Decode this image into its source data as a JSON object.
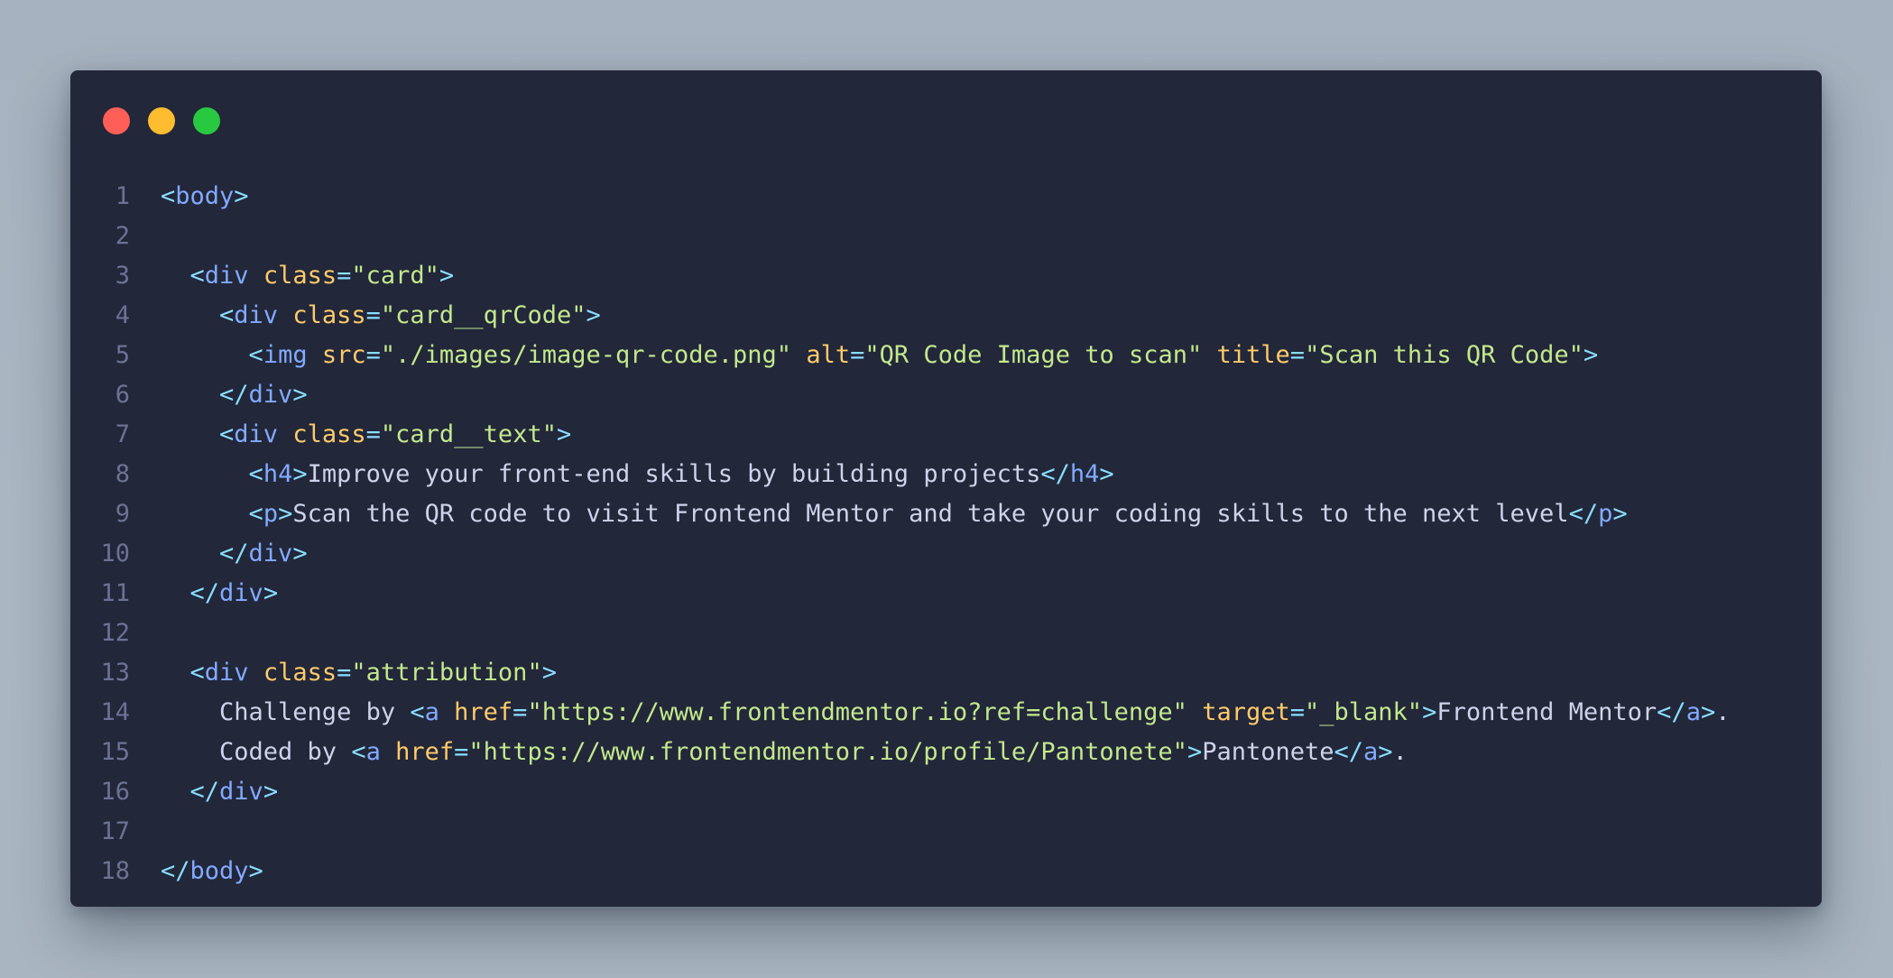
{
  "colors": {
    "background": "#aab6c2",
    "window": "#22273a",
    "line_number": "#6b7394",
    "punctuation": "#89ddff",
    "tag": "#82aaff",
    "attribute": "#ffcb6b",
    "string": "#c3e88d",
    "text": "#cdd3ea",
    "close_dot": "#ff5f57",
    "minimize_dot": "#febc2e",
    "zoom_dot": "#28c840"
  },
  "lines": [
    {
      "n": "1",
      "tokens": [
        [
          "p",
          "<"
        ],
        [
          "t",
          "body"
        ],
        [
          "p",
          ">"
        ]
      ]
    },
    {
      "n": "2",
      "tokens": []
    },
    {
      "n": "3",
      "tokens": [
        [
          "x",
          "  "
        ],
        [
          "p",
          "<"
        ],
        [
          "t",
          "div"
        ],
        [
          "x",
          " "
        ],
        [
          "a",
          "class"
        ],
        [
          "p",
          "="
        ],
        [
          "s",
          "\"card\""
        ],
        [
          "p",
          ">"
        ]
      ]
    },
    {
      "n": "4",
      "tokens": [
        [
          "x",
          "    "
        ],
        [
          "p",
          "<"
        ],
        [
          "t",
          "div"
        ],
        [
          "x",
          " "
        ],
        [
          "a",
          "class"
        ],
        [
          "p",
          "="
        ],
        [
          "s",
          "\"card__qrCode\""
        ],
        [
          "p",
          ">"
        ]
      ]
    },
    {
      "n": "5",
      "tokens": [
        [
          "x",
          "      "
        ],
        [
          "p",
          "<"
        ],
        [
          "t",
          "img"
        ],
        [
          "x",
          " "
        ],
        [
          "a",
          "src"
        ],
        [
          "p",
          "="
        ],
        [
          "s",
          "\"./images/image-qr-code.png\""
        ],
        [
          "x",
          " "
        ],
        [
          "a",
          "alt"
        ],
        [
          "p",
          "="
        ],
        [
          "s",
          "\"QR Code Image to scan\""
        ],
        [
          "x",
          " "
        ],
        [
          "a",
          "title"
        ],
        [
          "p",
          "="
        ],
        [
          "s",
          "\"Scan this QR Code\""
        ],
        [
          "p",
          ">"
        ]
      ]
    },
    {
      "n": "6",
      "tokens": [
        [
          "x",
          "    "
        ],
        [
          "p",
          "</"
        ],
        [
          "t",
          "div"
        ],
        [
          "p",
          ">"
        ]
      ]
    },
    {
      "n": "7",
      "tokens": [
        [
          "x",
          "    "
        ],
        [
          "p",
          "<"
        ],
        [
          "t",
          "div"
        ],
        [
          "x",
          " "
        ],
        [
          "a",
          "class"
        ],
        [
          "p",
          "="
        ],
        [
          "s",
          "\"card__text\""
        ],
        [
          "p",
          ">"
        ]
      ]
    },
    {
      "n": "8",
      "tokens": [
        [
          "x",
          "      "
        ],
        [
          "p",
          "<"
        ],
        [
          "t",
          "h4"
        ],
        [
          "p",
          ">"
        ],
        [
          "x",
          "Improve your front-end skills by building projects"
        ],
        [
          "p",
          "</"
        ],
        [
          "t",
          "h4"
        ],
        [
          "p",
          ">"
        ]
      ]
    },
    {
      "n": "9",
      "tokens": [
        [
          "x",
          "      "
        ],
        [
          "p",
          "<"
        ],
        [
          "t",
          "p"
        ],
        [
          "p",
          ">"
        ],
        [
          "x",
          "Scan the QR code to visit Frontend Mentor and take your coding skills to the next level"
        ],
        [
          "p",
          "</"
        ],
        [
          "t",
          "p"
        ],
        [
          "p",
          ">"
        ]
      ]
    },
    {
      "n": "10",
      "tokens": [
        [
          "x",
          "    "
        ],
        [
          "p",
          "</"
        ],
        [
          "t",
          "div"
        ],
        [
          "p",
          ">"
        ]
      ]
    },
    {
      "n": "11",
      "tokens": [
        [
          "x",
          "  "
        ],
        [
          "p",
          "</"
        ],
        [
          "t",
          "div"
        ],
        [
          "p",
          ">"
        ]
      ]
    },
    {
      "n": "12",
      "tokens": []
    },
    {
      "n": "13",
      "tokens": [
        [
          "x",
          "  "
        ],
        [
          "p",
          "<"
        ],
        [
          "t",
          "div"
        ],
        [
          "x",
          " "
        ],
        [
          "a",
          "class"
        ],
        [
          "p",
          "="
        ],
        [
          "s",
          "\"attribution\""
        ],
        [
          "p",
          ">"
        ]
      ]
    },
    {
      "n": "14",
      "tokens": [
        [
          "x",
          "    Challenge by "
        ],
        [
          "p",
          "<"
        ],
        [
          "t",
          "a"
        ],
        [
          "x",
          " "
        ],
        [
          "a",
          "href"
        ],
        [
          "p",
          "="
        ],
        [
          "s",
          "\"https://www.frontendmentor.io?ref=challenge\""
        ],
        [
          "x",
          " "
        ],
        [
          "a",
          "target"
        ],
        [
          "p",
          "="
        ],
        [
          "s",
          "\"_blank\""
        ],
        [
          "p",
          ">"
        ],
        [
          "x",
          "Frontend Mentor"
        ],
        [
          "p",
          "</"
        ],
        [
          "t",
          "a"
        ],
        [
          "p",
          ">"
        ],
        [
          "x",
          "."
        ]
      ]
    },
    {
      "n": "15",
      "tokens": [
        [
          "x",
          "    Coded by "
        ],
        [
          "p",
          "<"
        ],
        [
          "t",
          "a"
        ],
        [
          "x",
          " "
        ],
        [
          "a",
          "href"
        ],
        [
          "p",
          "="
        ],
        [
          "s",
          "\"https://www.frontendmentor.io/profile/Pantonete\""
        ],
        [
          "p",
          ">"
        ],
        [
          "x",
          "Pantonete"
        ],
        [
          "p",
          "</"
        ],
        [
          "t",
          "a"
        ],
        [
          "p",
          ">"
        ],
        [
          "x",
          "."
        ]
      ]
    },
    {
      "n": "16",
      "tokens": [
        [
          "x",
          "  "
        ],
        [
          "p",
          "</"
        ],
        [
          "t",
          "div"
        ],
        [
          "p",
          ">"
        ]
      ]
    },
    {
      "n": "17",
      "tokens": []
    },
    {
      "n": "18",
      "tokens": [
        [
          "p",
          "</"
        ],
        [
          "t",
          "body"
        ],
        [
          "p",
          ">"
        ]
      ]
    }
  ]
}
